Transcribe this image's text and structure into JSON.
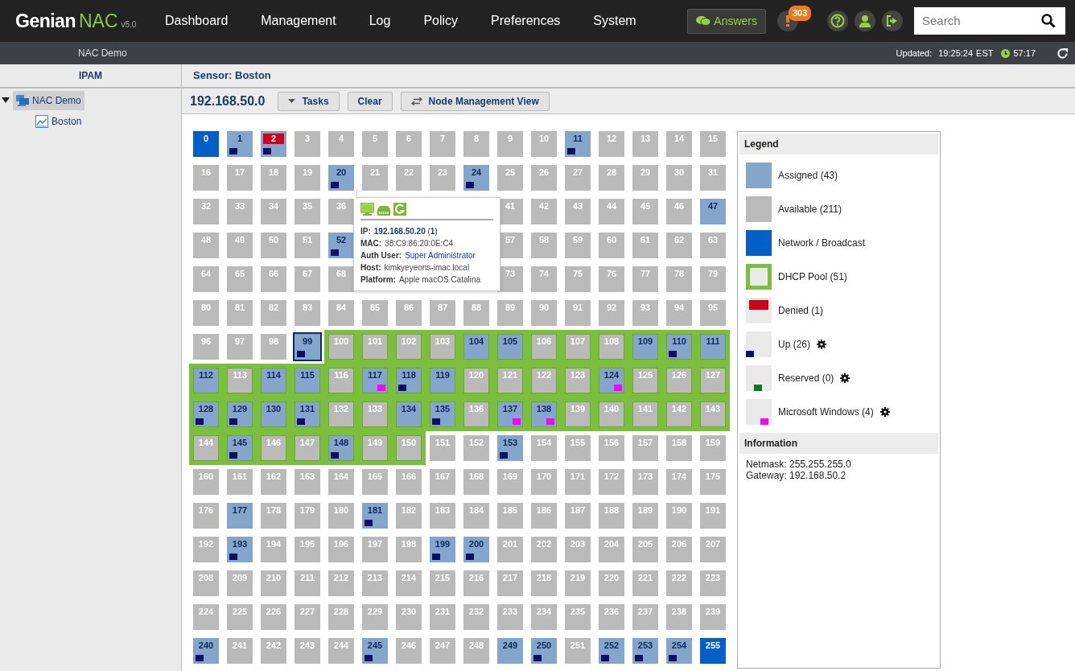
{
  "navbar": {
    "brand": "Genian",
    "product": "NAC",
    "version": "v5.0",
    "menu": [
      "Dashboard",
      "Management",
      "Log",
      "Policy",
      "Preferences",
      "System"
    ],
    "answers": "Answers",
    "alerts": "303",
    "search": {
      "placeholder": "Search"
    }
  },
  "subbar": {
    "site": "NAC Demo",
    "updated_label": "Updated:",
    "updated_time": "19:25:24",
    "timezone": "EST",
    "session": "57:17"
  },
  "sidebar": {
    "title": "IPAM",
    "tree": [
      {
        "label": "NAC Demo",
        "selected": true,
        "expanded": true,
        "children": [
          {
            "label": "Boston",
            "selected": false
          }
        ]
      }
    ]
  },
  "main": {
    "title": "Sensor: Boston",
    "network": "192.168.50.0",
    "buttons": [
      {
        "label": "Tasks",
        "kind": "menu"
      },
      {
        "label": "Clear",
        "kind": "plain"
      },
      {
        "label": "Node Management View",
        "kind": "switch"
      }
    ],
    "rows": [
      [
        {
          "label": "0",
          "kind": "network",
          "dhcp": false,
          "selected": false
        },
        {
          "label": "1",
          "kind": "assigned",
          "dhcp": false,
          "selected": false,
          "up": true
        },
        {
          "label": "2",
          "kind": "denied",
          "dhcp": false,
          "selected": false,
          "up": true
        },
        {
          "label": "3",
          "kind": "available",
          "dhcp": false,
          "selected": false
        },
        {
          "label": "4",
          "kind": "available",
          "dhcp": false,
          "selected": false
        },
        {
          "label": "5",
          "kind": "available",
          "dhcp": false,
          "selected": false
        },
        {
          "label": "6",
          "kind": "available",
          "dhcp": false,
          "selected": false
        },
        {
          "label": "7",
          "kind": "available",
          "dhcp": false,
          "selected": false
        },
        {
          "label": "8",
          "kind": "available",
          "dhcp": false,
          "selected": false
        },
        {
          "label": "9",
          "kind": "available",
          "dhcp": false,
          "selected": false
        },
        {
          "label": "10",
          "kind": "available",
          "dhcp": false,
          "selected": false
        },
        {
          "label": "11",
          "kind": "assigned",
          "dhcp": false,
          "selected": false,
          "up": true
        },
        {
          "label": "12",
          "kind": "available",
          "dhcp": false,
          "selected": false
        },
        {
          "label": "13",
          "kind": "available",
          "dhcp": false,
          "selected": false
        },
        {
          "label": "14",
          "kind": "available",
          "dhcp": false,
          "selected": false
        },
        {
          "label": "15",
          "kind": "available",
          "dhcp": false,
          "selected": false
        }
      ],
      [
        {
          "label": "16",
          "kind": "available",
          "dhcp": false,
          "selected": false
        },
        {
          "label": "17",
          "kind": "available",
          "dhcp": false,
          "selected": false
        },
        {
          "label": "18",
          "kind": "available",
          "dhcp": false,
          "selected": false
        },
        {
          "label": "19",
          "kind": "available",
          "dhcp": false,
          "selected": false
        },
        {
          "label": "20",
          "kind": "assigned",
          "dhcp": false,
          "selected": false,
          "up": true
        },
        {
          "label": "21",
          "kind": "available",
          "dhcp": false,
          "selected": false
        },
        {
          "label": "22",
          "kind": "available",
          "dhcp": false,
          "selected": false
        },
        {
          "label": "23",
          "kind": "available",
          "dhcp": false,
          "selected": false
        },
        {
          "label": "24",
          "kind": "assigned",
          "dhcp": false,
          "selected": false,
          "up": true
        },
        {
          "label": "25",
          "kind": "available",
          "dhcp": false,
          "selected": false
        },
        {
          "label": "26",
          "kind": "available",
          "dhcp": false,
          "selected": false
        },
        {
          "label": "27",
          "kind": "available",
          "dhcp": false,
          "selected": false
        },
        {
          "label": "28",
          "kind": "available",
          "dhcp": false,
          "selected": false
        },
        {
          "label": "29",
          "kind": "available",
          "dhcp": false,
          "selected": false
        },
        {
          "label": "30",
          "kind": "available",
          "dhcp": false,
          "selected": false
        },
        {
          "label": "31",
          "kind": "available",
          "dhcp": false,
          "selected": false
        }
      ],
      [
        {
          "label": "32",
          "kind": "available",
          "dhcp": false,
          "selected": false
        },
        {
          "label": "33",
          "kind": "available",
          "dhcp": false,
          "selected": false
        },
        {
          "label": "34",
          "kind": "available",
          "dhcp": false,
          "selected": false
        },
        {
          "label": "35",
          "kind": "available",
          "dhcp": false,
          "selected": false
        },
        {
          "label": "36",
          "kind": "available",
          "dhcp": false,
          "selected": false
        },
        {
          "kind": "covered"
        },
        {
          "kind": "covered"
        },
        {
          "kind": "covered"
        },
        {
          "kind": "covered"
        },
        {
          "label": "41",
          "kind": "available",
          "dhcp": false,
          "selected": false
        },
        {
          "label": "42",
          "kind": "available",
          "dhcp": false,
          "selected": false
        },
        {
          "label": "43",
          "kind": "available",
          "dhcp": false,
          "selected": false
        },
        {
          "label": "44",
          "kind": "available",
          "dhcp": false,
          "selected": false
        },
        {
          "label": "45",
          "kind": "available",
          "dhcp": false,
          "selected": false
        },
        {
          "label": "46",
          "kind": "available",
          "dhcp": false,
          "selected": false
        },
        {
          "label": "47",
          "kind": "assigned",
          "dhcp": false,
          "selected": false
        }
      ],
      [
        {
          "label": "48",
          "kind": "available",
          "dhcp": false,
          "selected": false
        },
        {
          "label": "49",
          "kind": "available",
          "dhcp": false,
          "selected": false
        },
        {
          "label": "50",
          "kind": "available",
          "dhcp": false,
          "selected": false
        },
        {
          "label": "51",
          "kind": "available",
          "dhcp": false,
          "selected": false
        },
        {
          "label": "52",
          "kind": "assigned",
          "dhcp": false,
          "selected": false,
          "up": true
        },
        {
          "kind": "covered"
        },
        {
          "kind": "covered"
        },
        {
          "kind": "covered"
        },
        {
          "kind": "covered"
        },
        {
          "label": "57",
          "kind": "available",
          "dhcp": false,
          "selected": false
        },
        {
          "label": "58",
          "kind": "available",
          "dhcp": false,
          "selected": false
        },
        {
          "label": "59",
          "kind": "available",
          "dhcp": false,
          "selected": false
        },
        {
          "label": "60",
          "kind": "available",
          "dhcp": false,
          "selected": false
        },
        {
          "label": "61",
          "kind": "available",
          "dhcp": false,
          "selected": false
        },
        {
          "label": "62",
          "kind": "available",
          "dhcp": false,
          "selected": false
        },
        {
          "label": "63",
          "kind": "available",
          "dhcp": false,
          "selected": false
        }
      ],
      [
        {
          "label": "64",
          "kind": "available",
          "dhcp": false,
          "selected": false
        },
        {
          "label": "65",
          "kind": "available",
          "dhcp": false,
          "selected": false
        },
        {
          "label": "66",
          "kind": "available",
          "dhcp": false,
          "selected": false
        },
        {
          "label": "67",
          "kind": "available",
          "dhcp": false,
          "selected": false
        },
        {
          "label": "68",
          "kind": "available",
          "dhcp": false,
          "selected": false
        },
        {
          "kind": "covered"
        },
        {
          "kind": "covered"
        },
        {
          "kind": "covered"
        },
        {
          "kind": "covered"
        },
        {
          "label": "73",
          "kind": "available",
          "dhcp": false,
          "selected": false
        },
        {
          "label": "74",
          "kind": "available",
          "dhcp": false,
          "selected": false
        },
        {
          "label": "75",
          "kind": "available",
          "dhcp": false,
          "selected": false
        },
        {
          "label": "76",
          "kind": "available",
          "dhcp": false,
          "selected": false
        },
        {
          "label": "77",
          "kind": "available",
          "dhcp": false,
          "selected": false
        },
        {
          "label": "78",
          "kind": "available",
          "dhcp": false,
          "selected": false
        },
        {
          "label": "79",
          "kind": "available",
          "dhcp": false,
          "selected": false
        }
      ],
      [
        {
          "label": "80",
          "kind": "available",
          "dhcp": false,
          "selected": false
        },
        {
          "label": "81",
          "kind": "available",
          "dhcp": false,
          "selected": false
        },
        {
          "label": "82",
          "kind": "available",
          "dhcp": false,
          "selected": false
        },
        {
          "label": "83",
          "kind": "available",
          "dhcp": false,
          "selected": false
        },
        {
          "label": "84",
          "kind": "available",
          "dhcp": false,
          "selected": false
        },
        {
          "label": "85",
          "kind": "available",
          "dhcp": false,
          "selected": false
        },
        {
          "label": "86",
          "kind": "available",
          "dhcp": false,
          "selected": false
        },
        {
          "label": "87",
          "kind": "available",
          "dhcp": false,
          "selected": false
        },
        {
          "label": "88",
          "kind": "available",
          "dhcp": false,
          "selected": false
        },
        {
          "label": "89",
          "kind": "available",
          "dhcp": false,
          "selected": false
        },
        {
          "label": "90",
          "kind": "available",
          "dhcp": false,
          "selected": false
        },
        {
          "label": "91",
          "kind": "available",
          "dhcp": false,
          "selected": false
        },
        {
          "label": "92",
          "kind": "available",
          "dhcp": false,
          "selected": false
        },
        {
          "label": "93",
          "kind": "available",
          "dhcp": false,
          "selected": false
        },
        {
          "label": "94",
          "kind": "available",
          "dhcp": false,
          "selected": false
        },
        {
          "label": "95",
          "kind": "available",
          "dhcp": false,
          "selected": false
        }
      ],
      [
        {
          "label": "96",
          "kind": "available",
          "dhcp": false,
          "selected": false
        },
        {
          "label": "97",
          "kind": "available",
          "dhcp": false,
          "selected": false
        },
        {
          "label": "98",
          "kind": "available",
          "dhcp": false,
          "selected": false
        },
        {
          "label": "99",
          "kind": "assigned",
          "dhcp": false,
          "selected": true,
          "up": true
        },
        {
          "label": "100",
          "kind": "available",
          "dhcp": true,
          "selected": false
        },
        {
          "label": "101",
          "kind": "available",
          "dhcp": true,
          "selected": false
        },
        {
          "label": "102",
          "kind": "available",
          "dhcp": true,
          "selected": false
        },
        {
          "label": "103",
          "kind": "available",
          "dhcp": true,
          "selected": false
        },
        {
          "label": "104",
          "kind": "assigned",
          "dhcp": true,
          "selected": false
        },
        {
          "label": "105",
          "kind": "assigned",
          "dhcp": true,
          "selected": false
        },
        {
          "label": "106",
          "kind": "available",
          "dhcp": true,
          "selected": false
        },
        {
          "label": "107",
          "kind": "available",
          "dhcp": true,
          "selected": false
        },
        {
          "label": "108",
          "kind": "available",
          "dhcp": true,
          "selected": false
        },
        {
          "label": "109",
          "kind": "assigned",
          "dhcp": true,
          "selected": false
        },
        {
          "label": "110",
          "kind": "assigned",
          "dhcp": true,
          "selected": false,
          "up": true
        },
        {
          "label": "111",
          "kind": "assigned",
          "dhcp": true,
          "selected": false
        }
      ],
      [
        {
          "label": "112",
          "kind": "assigned",
          "dhcp": true,
          "selected": false
        },
        {
          "label": "113",
          "kind": "available",
          "dhcp": true,
          "selected": false
        },
        {
          "label": "114",
          "kind": "assigned",
          "dhcp": true,
          "selected": false
        },
        {
          "label": "115",
          "kind": "assigned",
          "dhcp": true,
          "selected": false
        },
        {
          "label": "116",
          "kind": "available",
          "dhcp": true,
          "selected": false
        },
        {
          "label": "117",
          "kind": "assigned",
          "dhcp": true,
          "selected": false,
          "windows": true
        },
        {
          "label": "118",
          "kind": "assigned",
          "dhcp": true,
          "selected": false,
          "up": true
        },
        {
          "label": "119",
          "kind": "assigned",
          "dhcp": true,
          "selected": false
        },
        {
          "label": "120",
          "kind": "available",
          "dhcp": true,
          "selected": false
        },
        {
          "label": "121",
          "kind": "available",
          "dhcp": true,
          "selected": false
        },
        {
          "label": "122",
          "kind": "available",
          "dhcp": true,
          "selected": false
        },
        {
          "label": "123",
          "kind": "available",
          "dhcp": true,
          "selected": false
        },
        {
          "label": "124",
          "kind": "assigned",
          "dhcp": true,
          "selected": false,
          "windows": true
        },
        {
          "label": "125",
          "kind": "available",
          "dhcp": true,
          "selected": false
        },
        {
          "label": "126",
          "kind": "available",
          "dhcp": true,
          "selected": false
        },
        {
          "label": "127",
          "kind": "available",
          "dhcp": true,
          "selected": false
        }
      ],
      [
        {
          "label": "128",
          "kind": "assigned",
          "dhcp": true,
          "selected": false,
          "up": true
        },
        {
          "label": "129",
          "kind": "assigned",
          "dhcp": true,
          "selected": false,
          "up": true
        },
        {
          "label": "130",
          "kind": "assigned",
          "dhcp": true,
          "selected": false
        },
        {
          "label": "131",
          "kind": "assigned",
          "dhcp": true,
          "selected": false,
          "up": true
        },
        {
          "label": "132",
          "kind": "available",
          "dhcp": true,
          "selected": false
        },
        {
          "label": "133",
          "kind": "available",
          "dhcp": true,
          "selected": false
        },
        {
          "label": "134",
          "kind": "assigned",
          "dhcp": true,
          "selected": false
        },
        {
          "label": "135",
          "kind": "assigned",
          "dhcp": true,
          "selected": false,
          "up": true
        },
        {
          "label": "136",
          "kind": "available",
          "dhcp": true,
          "selected": false
        },
        {
          "label": "137",
          "kind": "assigned",
          "dhcp": true,
          "selected": false,
          "windows": true
        },
        {
          "label": "138",
          "kind": "assigned",
          "dhcp": true,
          "selected": false,
          "windows": true
        },
        {
          "label": "139",
          "kind": "available",
          "dhcp": true,
          "selected": false
        },
        {
          "label": "140",
          "kind": "available",
          "dhcp": true,
          "selected": false
        },
        {
          "label": "141",
          "kind": "available",
          "dhcp": true,
          "selected": false
        },
        {
          "label": "142",
          "kind": "available",
          "dhcp": true,
          "selected": false
        },
        {
          "label": "143",
          "kind": "available",
          "dhcp": true,
          "selected": false
        }
      ],
      [
        {
          "label": "144",
          "kind": "available",
          "dhcp": true,
          "selected": false
        },
        {
          "label": "145",
          "kind": "assigned",
          "dhcp": true,
          "selected": false,
          "up": true
        },
        {
          "label": "146",
          "kind": "available",
          "dhcp": true,
          "selected": false
        },
        {
          "label": "147",
          "kind": "available",
          "dhcp": true,
          "selected": false
        },
        {
          "label": "148",
          "kind": "assigned",
          "dhcp": true,
          "selected": false,
          "up": true
        },
        {
          "label": "149",
          "kind": "available",
          "dhcp": true,
          "selected": false
        },
        {
          "label": "150",
          "kind": "available",
          "dhcp": true,
          "selected": false
        },
        {
          "label": "151",
          "kind": "available",
          "dhcp": false,
          "selected": false
        },
        {
          "label": "152",
          "kind": "available",
          "dhcp": false,
          "selected": false
        },
        {
          "label": "153",
          "kind": "assigned",
          "dhcp": false,
          "selected": false,
          "up": true
        },
        {
          "label": "154",
          "kind": "available",
          "dhcp": false,
          "selected": false
        },
        {
          "label": "155",
          "kind": "available",
          "dhcp": false,
          "selected": false
        },
        {
          "label": "156",
          "kind": "available",
          "dhcp": false,
          "selected": false
        },
        {
          "label": "157",
          "kind": "available",
          "dhcp": false,
          "selected": false
        },
        {
          "label": "158",
          "kind": "available",
          "dhcp": false,
          "selected": false
        },
        {
          "label": "159",
          "kind": "available",
          "dhcp": false,
          "selected": false
        }
      ],
      [
        {
          "label": "160",
          "kind": "available",
          "dhcp": false,
          "selected": false
        },
        {
          "label": "161",
          "kind": "available",
          "dhcp": false,
          "selected": false
        },
        {
          "label": "162",
          "kind": "available",
          "dhcp": false,
          "selected": false
        },
        {
          "label": "163",
          "kind": "available",
          "dhcp": false,
          "selected": false
        },
        {
          "label": "164",
          "kind": "available",
          "dhcp": false,
          "selected": false
        },
        {
          "label": "165",
          "kind": "available",
          "dhcp": false,
          "selected": false
        },
        {
          "label": "166",
          "kind": "available",
          "dhcp": false,
          "selected": false
        },
        {
          "label": "167",
          "kind": "available",
          "dhcp": false,
          "selected": false
        },
        {
          "label": "168",
          "kind": "available",
          "dhcp": false,
          "selected": false
        },
        {
          "label": "169",
          "kind": "available",
          "dhcp": false,
          "selected": false
        },
        {
          "label": "170",
          "kind": "available",
          "dhcp": false,
          "selected": false
        },
        {
          "label": "171",
          "kind": "available",
          "dhcp": false,
          "selected": false
        },
        {
          "label": "172",
          "kind": "available",
          "dhcp": false,
          "selected": false
        },
        {
          "label": "173",
          "kind": "available",
          "dhcp": false,
          "selected": false
        },
        {
          "label": "174",
          "kind": "available",
          "dhcp": false,
          "selected": false
        },
        {
          "label": "175",
          "kind": "available",
          "dhcp": false,
          "selected": false
        }
      ],
      [
        {
          "label": "176",
          "kind": "available",
          "dhcp": false,
          "selected": false
        },
        {
          "label": "177",
          "kind": "assigned",
          "dhcp": false,
          "selected": false
        },
        {
          "label": "178",
          "kind": "available",
          "dhcp": false,
          "selected": false
        },
        {
          "label": "179",
          "kind": "available",
          "dhcp": false,
          "selected": false
        },
        {
          "label": "180",
          "kind": "available",
          "dhcp": false,
          "selected": false
        },
        {
          "label": "181",
          "kind": "assigned",
          "dhcp": false,
          "selected": false,
          "up": true
        },
        {
          "label": "182",
          "kind": "available",
          "dhcp": false,
          "selected": false
        },
        {
          "label": "183",
          "kind": "available",
          "dhcp": false,
          "selected": false
        },
        {
          "label": "184",
          "kind": "available",
          "dhcp": false,
          "selected": false
        },
        {
          "label": "185",
          "kind": "available",
          "dhcp": false,
          "selected": false
        },
        {
          "label": "186",
          "kind": "available",
          "dhcp": false,
          "selected": false
        },
        {
          "label": "187",
          "kind": "available",
          "dhcp": false,
          "selected": false
        },
        {
          "label": "188",
          "kind": "available",
          "dhcp": false,
          "selected": false
        },
        {
          "label": "189",
          "kind": "available",
          "dhcp": false,
          "selected": false
        },
        {
          "label": "190",
          "kind": "available",
          "dhcp": false,
          "selected": false
        },
        {
          "label": "191",
          "kind": "available",
          "dhcp": false,
          "selected": false
        }
      ],
      [
        {
          "label": "192",
          "kind": "available",
          "dhcp": false,
          "selected": false
        },
        {
          "label": "193",
          "kind": "assigned",
          "dhcp": false,
          "selected": false,
          "up": true
        },
        {
          "label": "194",
          "kind": "available",
          "dhcp": false,
          "selected": false
        },
        {
          "label": "195",
          "kind": "available",
          "dhcp": false,
          "selected": false
        },
        {
          "label": "196",
          "kind": "available",
          "dhcp": false,
          "selected": false
        },
        {
          "label": "197",
          "kind": "available",
          "dhcp": false,
          "selected": false
        },
        {
          "label": "198",
          "kind": "available",
          "dhcp": false,
          "selected": false
        },
        {
          "label": "199",
          "kind": "assigned",
          "dhcp": false,
          "selected": false,
          "up": true
        },
        {
          "label": "200",
          "kind": "assigned",
          "dhcp": false,
          "selected": false,
          "up": true
        },
        {
          "label": "201",
          "kind": "available",
          "dhcp": false,
          "selected": false
        },
        {
          "label": "202",
          "kind": "available",
          "dhcp": false,
          "selected": false
        },
        {
          "label": "203",
          "kind": "available",
          "dhcp": false,
          "selected": false
        },
        {
          "label": "204",
          "kind": "available",
          "dhcp": false,
          "selected": false
        },
        {
          "label": "205",
          "kind": "available",
          "dhcp": false,
          "selected": false
        },
        {
          "label": "206",
          "kind": "available",
          "dhcp": false,
          "selected": false
        },
        {
          "label": "207",
          "kind": "available",
          "dhcp": false,
          "selected": false
        }
      ],
      [
        {
          "label": "208",
          "kind": "available",
          "dhcp": false,
          "selected": false
        },
        {
          "label": "209",
          "kind": "available",
          "dhcp": false,
          "selected": false
        },
        {
          "label": "210",
          "kind": "available",
          "dhcp": false,
          "selected": false
        },
        {
          "label": "211",
          "kind": "available",
          "dhcp": false,
          "selected": false
        },
        {
          "label": "212",
          "kind": "available",
          "dhcp": false,
          "selected": false
        },
        {
          "label": "213",
          "kind": "available",
          "dhcp": false,
          "selected": false
        },
        {
          "label": "214",
          "kind": "available",
          "dhcp": false,
          "selected": false
        },
        {
          "label": "215",
          "kind": "available",
          "dhcp": false,
          "selected": false
        },
        {
          "label": "216",
          "kind": "available",
          "dhcp": false,
          "selected": false
        },
        {
          "label": "217",
          "kind": "available",
          "dhcp": false,
          "selected": false
        },
        {
          "label": "218",
          "kind": "available",
          "dhcp": false,
          "selected": false
        },
        {
          "label": "219",
          "kind": "available",
          "dhcp": false,
          "selected": false
        },
        {
          "label": "220",
          "kind": "available",
          "dhcp": false,
          "selected": false
        },
        {
          "label": "221",
          "kind": "available",
          "dhcp": false,
          "selected": false
        },
        {
          "label": "222",
          "kind": "available",
          "dhcp": false,
          "selected": false
        },
        {
          "label": "223",
          "kind": "available",
          "dhcp": false,
          "selected": false
        }
      ],
      [
        {
          "label": "224",
          "kind": "available",
          "dhcp": false,
          "selected": false
        },
        {
          "label": "225",
          "kind": "available",
          "dhcp": false,
          "selected": false
        },
        {
          "label": "226",
          "kind": "available",
          "dhcp": false,
          "selected": false
        },
        {
          "label": "227",
          "kind": "available",
          "dhcp": false,
          "selected": false
        },
        {
          "label": "228",
          "kind": "available",
          "dhcp": false,
          "selected": false
        },
        {
          "label": "229",
          "kind": "available",
          "dhcp": false,
          "selected": false
        },
        {
          "label": "230",
          "kind": "available",
          "dhcp": false,
          "selected": false
        },
        {
          "label": "231",
          "kind": "available",
          "dhcp": false,
          "selected": false
        },
        {
          "label": "232",
          "kind": "available",
          "dhcp": false,
          "selected": false
        },
        {
          "label": "233",
          "kind": "available",
          "dhcp": false,
          "selected": false
        },
        {
          "label": "234",
          "kind": "available",
          "dhcp": false,
          "selected": false
        },
        {
          "label": "235",
          "kind": "available",
          "dhcp": false,
          "selected": false
        },
        {
          "label": "236",
          "kind": "available",
          "dhcp": false,
          "selected": false
        },
        {
          "label": "237",
          "kind": "available",
          "dhcp": false,
          "selected": false
        },
        {
          "label": "238",
          "kind": "available",
          "dhcp": false,
          "selected": false
        },
        {
          "label": "239",
          "kind": "available",
          "dhcp": false,
          "selected": false
        }
      ],
      [
        {
          "label": "240",
          "kind": "assigned",
          "dhcp": false,
          "selected": false,
          "up": true
        },
        {
          "label": "241",
          "kind": "available",
          "dhcp": false,
          "selected": false
        },
        {
          "label": "242",
          "kind": "available",
          "dhcp": false,
          "selected": false
        },
        {
          "label": "243",
          "kind": "available",
          "dhcp": false,
          "selected": false
        },
        {
          "label": "244",
          "kind": "available",
          "dhcp": false,
          "selected": false
        },
        {
          "label": "245",
          "kind": "assigned",
          "dhcp": false,
          "selected": false,
          "up": true
        },
        {
          "label": "246",
          "kind": "available",
          "dhcp": false,
          "selected": false
        },
        {
          "label": "247",
          "kind": "available",
          "dhcp": false,
          "selected": false
        },
        {
          "label": "248",
          "kind": "available",
          "dhcp": false,
          "selected": false
        },
        {
          "label": "249",
          "kind": "assigned",
          "dhcp": false,
          "selected": false
        },
        {
          "label": "250",
          "kind": "assigned",
          "dhcp": false,
          "selected": false,
          "up": true
        },
        {
          "label": "251",
          "kind": "available",
          "dhcp": false,
          "selected": false
        },
        {
          "label": "252",
          "kind": "assigned",
          "dhcp": false,
          "selected": false,
          "up": true
        },
        {
          "label": "253",
          "kind": "assigned",
          "dhcp": false,
          "selected": false,
          "up": true
        },
        {
          "label": "254",
          "kind": "assigned",
          "dhcp": false,
          "selected": false,
          "up": true
        },
        {
          "label": "255",
          "kind": "network",
          "dhcp": false,
          "selected": false
        }
      ]
    ],
    "tooltip": {
      "fields": [
        {
          "label": "IP:",
          "value": "**192.168.50.20** (**1**)",
          "kind": "link"
        },
        {
          "label": "MAC:",
          "value": "38:C9:86:20:0E:C4",
          "kind": "text"
        },
        {
          "label": "Auth User:",
          "value": "Super Administrator",
          "kind": "link"
        },
        {
          "label": "Host:",
          "value": "kimkyeyeons-imac.local",
          "kind": "text"
        },
        {
          "label": "Platform:",
          "value": "Apple macOS Catalina",
          "kind": "text"
        }
      ]
    }
  },
  "legend": {
    "title": "Legend",
    "items": [
      {
        "label": "Assigned (43)",
        "kind": "assigned",
        "gear": false
      },
      {
        "label": "Available (211)",
        "kind": "available",
        "gear": false
      },
      {
        "label": "Network / Broadcast",
        "kind": "network",
        "gear": false
      },
      {
        "label": "DHCP Pool (51)",
        "kind": "dhcp",
        "gear": false
      },
      {
        "label": "Denied (1)",
        "kind": "denied",
        "gear": false
      },
      {
        "label": "Up (26)",
        "kind": "up",
        "gear": true
      },
      {
        "label": "Reserved (0)",
        "kind": "reserved",
        "gear": true
      },
      {
        "label": "Microsoft Windows (4)",
        "kind": "windows",
        "gear": true
      }
    ]
  },
  "information": {
    "title": "Information",
    "lines": [
      "Netmask: 255.255.255.0",
      "Gateway: 192.168.50.2"
    ]
  }
}
